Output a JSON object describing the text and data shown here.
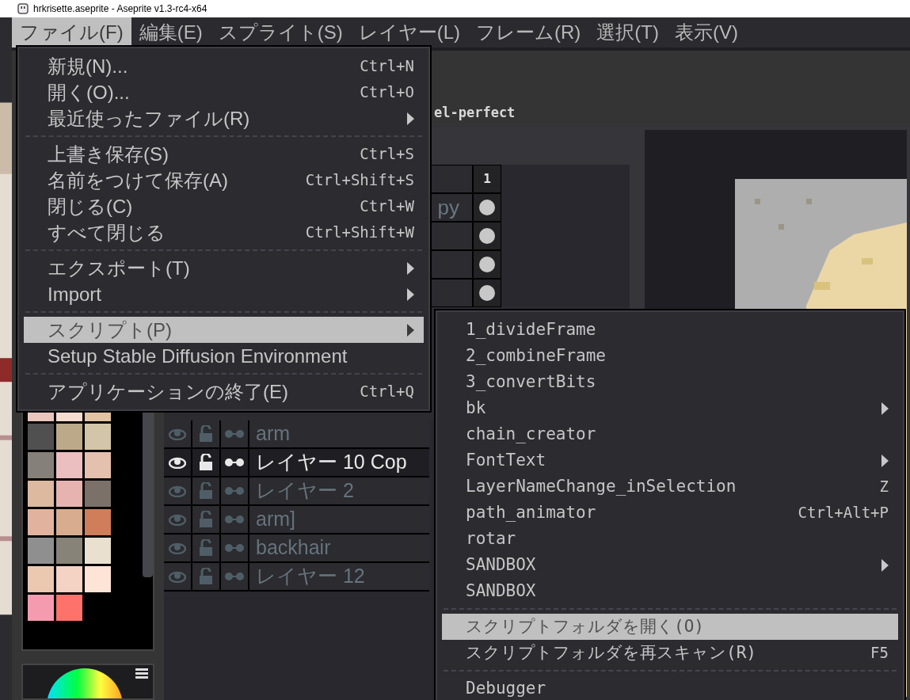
{
  "window": {
    "title": "hrkrisette.aseprite - Aseprite v1.3-rc4-x64"
  },
  "menu_bar": [
    {
      "label": "ファイル(F)",
      "selected": true
    },
    {
      "label": "編集(E)",
      "selected": false
    },
    {
      "label": "スプライト(S)",
      "selected": false
    },
    {
      "label": "レイヤー(L)",
      "selected": false
    },
    {
      "label": "フレーム(R)",
      "selected": false
    },
    {
      "label": "選択(T)",
      "selected": false
    },
    {
      "label": "表示(V)",
      "selected": false
    }
  ],
  "context_bar": {
    "text": "el-perfect"
  },
  "timeline": {
    "frame_header": "1",
    "partial_layer_name": "py",
    "cels": [
      {
        "filled": true
      },
      {
        "filled": true
      },
      {
        "filled": true
      },
      {
        "filled": true
      }
    ],
    "layers": [
      {
        "name": "arm",
        "selected": false
      },
      {
        "name": "レイヤー 10 Cop",
        "selected": true
      },
      {
        "name": "レイヤー 2",
        "selected": false
      },
      {
        "name": "arm]",
        "selected": false
      },
      {
        "name": "backhair",
        "selected": false
      },
      {
        "name": "レイヤー 12",
        "selected": false
      }
    ]
  },
  "palette": [
    {
      "color": "#e9c5be"
    },
    {
      "color": "#f5dcd0"
    },
    {
      "color": "#e2c3a4"
    },
    {
      "color": "#505050"
    },
    {
      "color": "#bca98a"
    },
    {
      "color": "#d3c6a8"
    },
    {
      "color": "#858079"
    },
    {
      "color": "#ebbec0"
    },
    {
      "color": "#e4c0af"
    },
    {
      "color": "#ddb9a0"
    },
    {
      "color": "#e7b3b0"
    },
    {
      "color": "#7c7169"
    },
    {
      "color": "#e1b39e"
    },
    {
      "color": "#d8ac8f"
    },
    {
      "color": "#cf7d5a"
    },
    {
      "color": "#8f8f8f"
    },
    {
      "color": "#878379"
    },
    {
      "color": "#e9e0d0"
    },
    {
      "color": "#ebc8b0"
    },
    {
      "color": "#f4d2c4"
    },
    {
      "color": "#fde4d6"
    },
    {
      "color": "#f59bb0"
    },
    {
      "color": "#fd736c"
    }
  ],
  "file_menu": [
    {
      "kind": "item",
      "label": "新規(N)...",
      "shortcut": "Ctrl+N",
      "selected": false
    },
    {
      "kind": "item",
      "label": "開く(O)...",
      "shortcut": "Ctrl+O",
      "selected": false
    },
    {
      "kind": "item",
      "label": "最近使ったファイル(R)",
      "submenu": true,
      "selected": false
    },
    {
      "kind": "separator"
    },
    {
      "kind": "item",
      "label": "上書き保存(S)",
      "shortcut": "Ctrl+S",
      "selected": false
    },
    {
      "kind": "item",
      "label": "名前をつけて保存(A)",
      "shortcut": "Ctrl+Shift+S",
      "selected": false
    },
    {
      "kind": "item",
      "label": "閉じる(C)",
      "shortcut": "Ctrl+W",
      "selected": false
    },
    {
      "kind": "item",
      "label": "すべて閉じる",
      "shortcut": "Ctrl+Shift+W",
      "selected": false
    },
    {
      "kind": "separator"
    },
    {
      "kind": "item",
      "label": "エクスポート(T)",
      "submenu": true,
      "selected": false
    },
    {
      "kind": "item",
      "label": "Import",
      "submenu": true,
      "selected": false
    },
    {
      "kind": "separator"
    },
    {
      "kind": "item",
      "label": "スクリプト(P)",
      "submenu": true,
      "selected": true
    },
    {
      "kind": "item",
      "label": "Setup Stable Diffusion Environment",
      "selected": false
    },
    {
      "kind": "separator"
    },
    {
      "kind": "item",
      "label": "アプリケーションの終了(E)",
      "shortcut": "Ctrl+Q",
      "selected": false
    }
  ],
  "script_menu": [
    {
      "kind": "item",
      "label": "1_divideFrame",
      "selected": false
    },
    {
      "kind": "item",
      "label": "2_combineFrame",
      "selected": false
    },
    {
      "kind": "item",
      "label": "3_convertBits",
      "selected": false
    },
    {
      "kind": "item",
      "label": "bk",
      "submenu": true,
      "selected": false
    },
    {
      "kind": "item",
      "label": "chain_creator",
      "selected": false
    },
    {
      "kind": "item",
      "label": "FontText",
      "submenu": true,
      "selected": false
    },
    {
      "kind": "item",
      "label": "LayerNameChange_inSelection",
      "shortcut": "Z",
      "selected": false
    },
    {
      "kind": "item",
      "label": "path_animator",
      "shortcut": "Ctrl+Alt+P",
      "selected": false
    },
    {
      "kind": "item",
      "label": "rotar",
      "selected": false
    },
    {
      "kind": "item",
      "label": "SANDBOX",
      "submenu": true,
      "selected": false
    },
    {
      "kind": "item",
      "label": "SANDBOX",
      "selected": false
    },
    {
      "kind": "separator"
    },
    {
      "kind": "item",
      "label": "スクリプトフォルダを開く(O)",
      "selected": true
    },
    {
      "kind": "item",
      "label": "スクリプトフォルダを再スキャン(R)",
      "shortcut": "F5",
      "selected": false
    },
    {
      "kind": "separator"
    },
    {
      "kind": "item",
      "label": "Debugger",
      "selected": false
    }
  ]
}
